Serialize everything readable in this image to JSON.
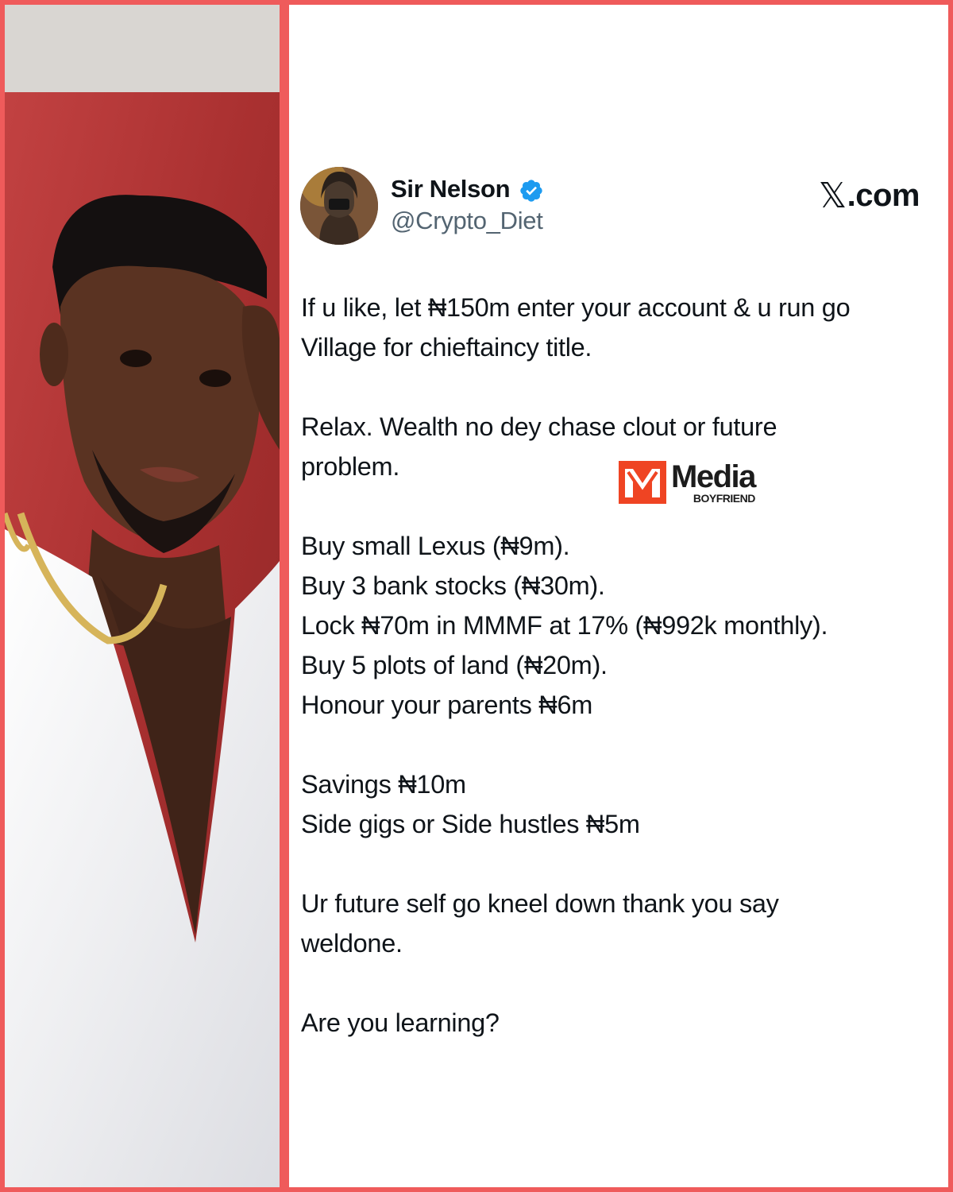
{
  "tweet": {
    "display_name": "Sir Nelson",
    "handle": "@Crypto_Diet",
    "source": "𝕏.com",
    "source_mark": "𝕏",
    "source_text": ".com",
    "paragraphs": [
      [
        "If u like, let ₦150m enter your account & u run go",
        "Village for chieftaincy title."
      ],
      [
        "Relax. Wealth no dey chase clout or future",
        "problem."
      ],
      [
        "Buy small Lexus (₦9m).",
        "Buy 3 bank stocks (₦30m).",
        "Lock ₦70m in MMMF at 17% (₦992k monthly).",
        "Buy 5 plots of land (₦20m).",
        "Honour your parents ₦6m"
      ],
      [
        "Savings ₦10m",
        "Side gigs or Side hustles ₦5m"
      ],
      [
        "Ur future self go kneel down thank you say",
        "weldone."
      ],
      [
        "Are you learning?"
      ]
    ]
  },
  "watermark": {
    "brand": "Media",
    "sub": "BOYFRIEND"
  },
  "colors": {
    "frame": "#ef5b5b",
    "verified": "#1d9bf0",
    "watermark_accent": "#ef4423"
  },
  "icons": {
    "verified": "verified-badge-icon",
    "x_logo": "x-logo-icon"
  }
}
